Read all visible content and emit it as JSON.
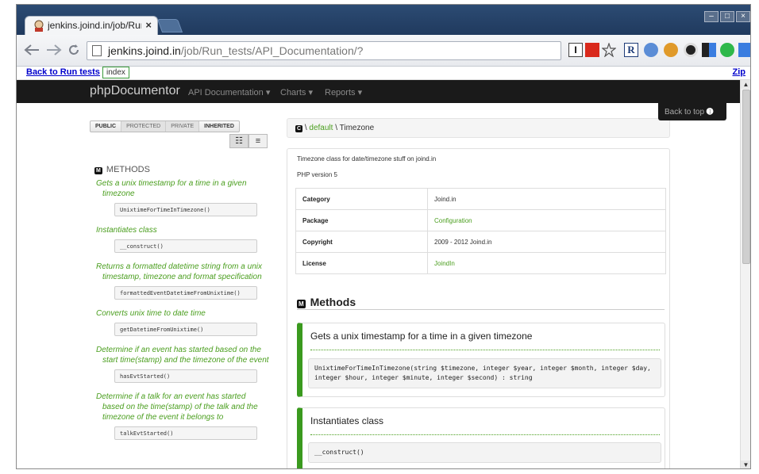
{
  "browser": {
    "tab_title": "jenkins.joind.in/job/Run",
    "tab_close": "×",
    "url_host": "jenkins.joind.in",
    "url_path": "/job/Run_tests/API_Documentation/?",
    "window_controls": [
      "–",
      "□",
      "×"
    ],
    "nav_icons": [
      "back-icon",
      "forward-icon",
      "reload-icon"
    ]
  },
  "linkbar": {
    "back_label": "Back to Run tests",
    "index_label": "index",
    "zip_label": "Zip"
  },
  "docnav": {
    "brand": "phpDocumentor",
    "menu": [
      "API Documentation",
      "Charts",
      "Reports"
    ]
  },
  "visibility": [
    "PUBLIC",
    "PROTECTED",
    "PRIVATE",
    "INHERITED"
  ],
  "sidebar": {
    "badge": "M",
    "heading": "METHODS",
    "methods": [
      {
        "desc": "Gets a unix timestamp for a time in a given timezone",
        "sig": "UnixtimeForTimeInTimezone()"
      },
      {
        "desc": "Instantiates class",
        "sig": "__construct()"
      },
      {
        "desc": "Returns a formatted datetime string from a unix timestamp, timezone and format specification",
        "sig": "formattedEventDatetimeFromUnixtime()"
      },
      {
        "desc": "Converts unix time to date time",
        "sig": "getDatetimeFromUnixtime()"
      },
      {
        "desc": "Determine if an event has started based on the start time(stamp) and the timezone of the event",
        "sig": "hasEvtStarted()"
      },
      {
        "desc": "Determine if a talk for an event has started based on the time(stamp) of the talk and the timezone of the event it belongs to",
        "sig": "talkEvtStarted()"
      }
    ]
  },
  "breadcrumb": {
    "badge": "C",
    "sep": "\\",
    "namespace": "default",
    "class": "Timezone"
  },
  "back_to_top": "Back to top",
  "class_info": {
    "description": "Timezone class for date/timezone stuff on joind.in",
    "php_version": "PHP version 5",
    "rows": [
      {
        "key": "Category",
        "value": "Joind.in",
        "link": false
      },
      {
        "key": "Package",
        "value": "Configuration",
        "link": true
      },
      {
        "key": "Copyright",
        "value": "2009 - 2012 Joind.in",
        "link": false
      },
      {
        "key": "License",
        "value": "JoindIn",
        "link": true
      }
    ]
  },
  "methods_section": {
    "badge": "M",
    "heading": "Methods",
    "cards": [
      {
        "title": "Gets a unix timestamp for a time in a given timezone",
        "signature": "UnixtimeForTimeInTimezone(string $timezone, integer $year, integer $month, integer $day, integer $hour, integer $minute, integer $second) : string"
      },
      {
        "title": "Instantiates class",
        "signature": "__construct()"
      }
    ]
  }
}
